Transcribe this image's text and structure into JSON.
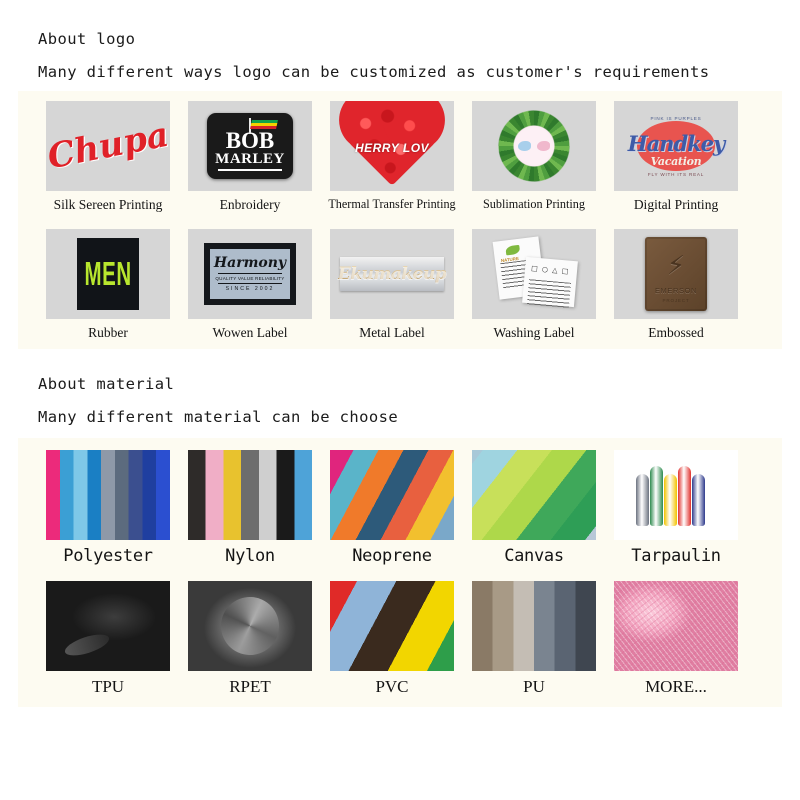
{
  "logo_section": {
    "title": "About logo",
    "subtitle": "Many different ways logo can be customized as customer's requirements",
    "items": [
      {
        "label": "Silk Sereen Printing",
        "art": "chupa-script-logo",
        "art_text": "Chupa",
        "colors": {
          "script": "#e02128",
          "background": "#d6d6d6"
        }
      },
      {
        "label": "Enbroidery",
        "art": "bob-marley-patch",
        "art_text_1": "BOB",
        "art_text_2": "MARLEY",
        "colors": {
          "patch": "#1a1a1a",
          "flag_green": "#12a24a",
          "flag_yellow": "#f5d000",
          "flag_red": "#d4232a"
        }
      },
      {
        "label": "Thermal Transfer Printing",
        "art": "rose-heart",
        "art_text": "HERRY LOV",
        "colors": {
          "roses": "#e0252c"
        }
      },
      {
        "label": "Sublimation Printing",
        "art": "leaf-wreath-with-birds",
        "colors": {
          "leaves": "#3a8630",
          "bird_left": "#a8cfeb",
          "bird_right": "#f0b8cc"
        }
      },
      {
        "label": "Digital Printing",
        "art": "handkey-vacation-logo",
        "art_text": "Handkey",
        "art_subtext": "Vacation",
        "art_toptext": "PINK IS PURPLES",
        "art_bottomtext": "FLY WITH ITS REAL",
        "colors": {
          "script": "#3d5ba8",
          "oval": "#e8544f"
        }
      }
    ]
  },
  "logo_section_row2": {
    "items": [
      {
        "label": "Rubber",
        "art": "men-neon-patch",
        "art_text": "MEN",
        "colors": {
          "text": "#b8e62e",
          "patch": "#111418"
        }
      },
      {
        "label": "Wowen Label",
        "art": "harmony-woven-label",
        "art_text": "Harmony",
        "art_line2": "QUALITY VALUE RELIABILITY",
        "art_line3": "SINCE 2002",
        "colors": {
          "border": "#15181c",
          "field": "#aebccb"
        }
      },
      {
        "label": "Metal Label",
        "art": "metal-nameplate",
        "art_text": "Ekumakeup",
        "colors": {
          "plate": "#c9ccd1",
          "letters": "#b08b4e"
        }
      },
      {
        "label": "Washing Label",
        "art": "washing-care-tags",
        "art_icons": "□ ○ △ □",
        "art_brand": "NATURE",
        "colors": {
          "tag": "#fbfbfb",
          "leaf": "#7fb93f"
        }
      },
      {
        "label": "Embossed",
        "art": "embossed-leather-patch",
        "art_text": "EMERSON",
        "art_subtext": "PROJECT",
        "art_symbol": "⚡",
        "colors": {
          "leather": "#6b4e34"
        }
      }
    ]
  },
  "material_section": {
    "title": "About material",
    "subtitle": "Many different material can be choose",
    "items": [
      {
        "label": "Polyester",
        "art": "vertical-fabric-stripes",
        "colors": [
          "#ec2a7b",
          "#3b9fd4",
          "#7ec8e8",
          "#1a7fc4",
          "#8e99a8",
          "#5c6b7e",
          "#3b4f8f",
          "#1f3fa0",
          "#2b4fd0"
        ]
      },
      {
        "label": "Nylon",
        "art": "vertical-fabric-stripes",
        "colors": [
          "#2e2b29",
          "#f0aec6",
          "#e8c22e",
          "#6d6d6d",
          "#cfcfcf",
          "#1a1a1a",
          "#4ea3d8"
        ]
      },
      {
        "label": "Neoprene",
        "art": "diagonal-fabric-stack",
        "colors": [
          "#2b3f9e",
          "#3f8fb8",
          "#e0257d",
          "#5ab4c9",
          "#f07a2a",
          "#2d5a7a",
          "#e8603f",
          "#f2c02e",
          "#7aa8c9",
          "#8a9e3a",
          "#5a4a3a"
        ]
      },
      {
        "label": "Canvas",
        "art": "diagonal-fabric-rolls",
        "colors": [
          "#c2a882",
          "#a8c8d8",
          "#9fd4e0",
          "#c8e05a",
          "#aed84a",
          "#3fa85a",
          "#2e9e56",
          "#b8c8d8",
          "#c9a8b8"
        ]
      },
      {
        "label": "Tarpaulin",
        "art": "rolled-tarp-bundle",
        "white_background": true,
        "colors": [
          "#6b7280",
          "#2e8b4f",
          "#f2c200",
          "#e0322e",
          "#2e3a8c"
        ]
      }
    ]
  },
  "material_section_row2": {
    "items": [
      {
        "label": "TPU",
        "art": "black-glossy-film",
        "colors": {
          "base": "#1a1a1a"
        }
      },
      {
        "label": "RPET",
        "art": "grey-draped-fabric",
        "colors": {
          "base": "#7a7a7a"
        }
      },
      {
        "label": "PVC",
        "art": "diagonal-color-sheets",
        "colors": [
          "#ede0cc",
          "#e02a28",
          "#8fb4d8",
          "#3a2a1e",
          "#f2d600",
          "#2e9e4a",
          "#1a6b3a"
        ]
      },
      {
        "label": "PU",
        "art": "vertical-leather-rolls",
        "colors": [
          "#8a7a66",
          "#a89a86",
          "#c4bdb4",
          "#7a8490",
          "#5a6472",
          "#3f4650"
        ]
      },
      {
        "label": "MORE...",
        "art": "pink-fur-fabric",
        "white_background": true,
        "colors": {
          "base": "#ea91b2"
        }
      }
    ]
  },
  "theme": {
    "panel_background": "#fdfbf1",
    "page_background": "#ffffff",
    "text_color": "#1b1b1b"
  }
}
